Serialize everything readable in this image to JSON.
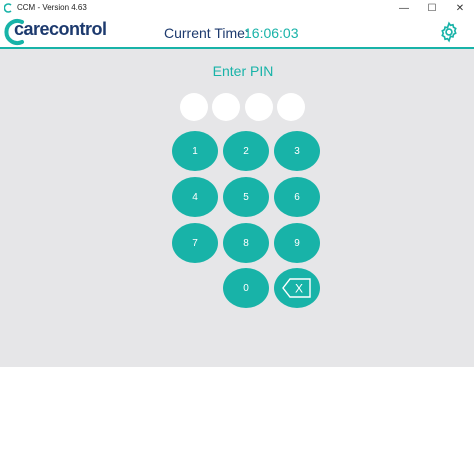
{
  "window": {
    "title": "CCM - Version 4.63",
    "minimize_glyph": "—",
    "maximize_glyph": "☐",
    "close_glyph": "✕"
  },
  "header": {
    "logo_c": "C",
    "logo_text": "carecontrol",
    "time_label": "Current Time:",
    "time_value": "16:06:03",
    "settings_icon": "gear-icon"
  },
  "pin": {
    "title": "Enter PIN",
    "dots_filled": 0,
    "dots_total": 4
  },
  "keypad": {
    "keys": [
      "1",
      "2",
      "3",
      "4",
      "5",
      "6",
      "7",
      "8",
      "9",
      "0"
    ],
    "backspace_label": "X"
  },
  "colors": {
    "accent": "#18b3a8",
    "brand_dark": "#1d3a6e",
    "panel_bg": "#e6e6e8"
  }
}
